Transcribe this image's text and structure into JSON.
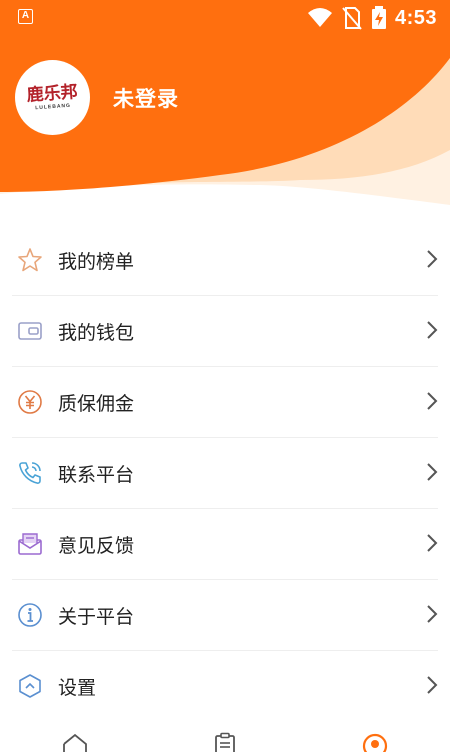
{
  "status_bar": {
    "app_icon_letter": "A",
    "time": "4:53"
  },
  "profile": {
    "avatar_text": "鹿乐邦",
    "avatar_subtext": "LULEBANG",
    "login_status": "未登录"
  },
  "menu": {
    "items": [
      {
        "label": "我的榜单",
        "icon": "star-icon",
        "color": "#e8a67a"
      },
      {
        "label": "我的钱包",
        "icon": "wallet-icon",
        "color": "#9aa0c8"
      },
      {
        "label": "质保佣金",
        "icon": "yen-icon",
        "color": "#e07a45"
      },
      {
        "label": "联系平台",
        "icon": "phone-icon",
        "color": "#4aa3d6"
      },
      {
        "label": "意见反馈",
        "icon": "mail-icon",
        "color": "#9b6ad0"
      },
      {
        "label": "关于平台",
        "icon": "info-icon",
        "color": "#5a8fd0"
      },
      {
        "label": "设置",
        "icon": "settings-hex-icon",
        "color": "#5a8fd0"
      }
    ]
  },
  "tabbar": {
    "tabs": [
      {
        "icon": "home-icon",
        "active": false
      },
      {
        "icon": "orders-icon",
        "active": false
      },
      {
        "icon": "profile-icon",
        "active": true
      }
    ]
  },
  "colors": {
    "accent": "#ff6f0f",
    "header_light": "#ffe6cc"
  }
}
